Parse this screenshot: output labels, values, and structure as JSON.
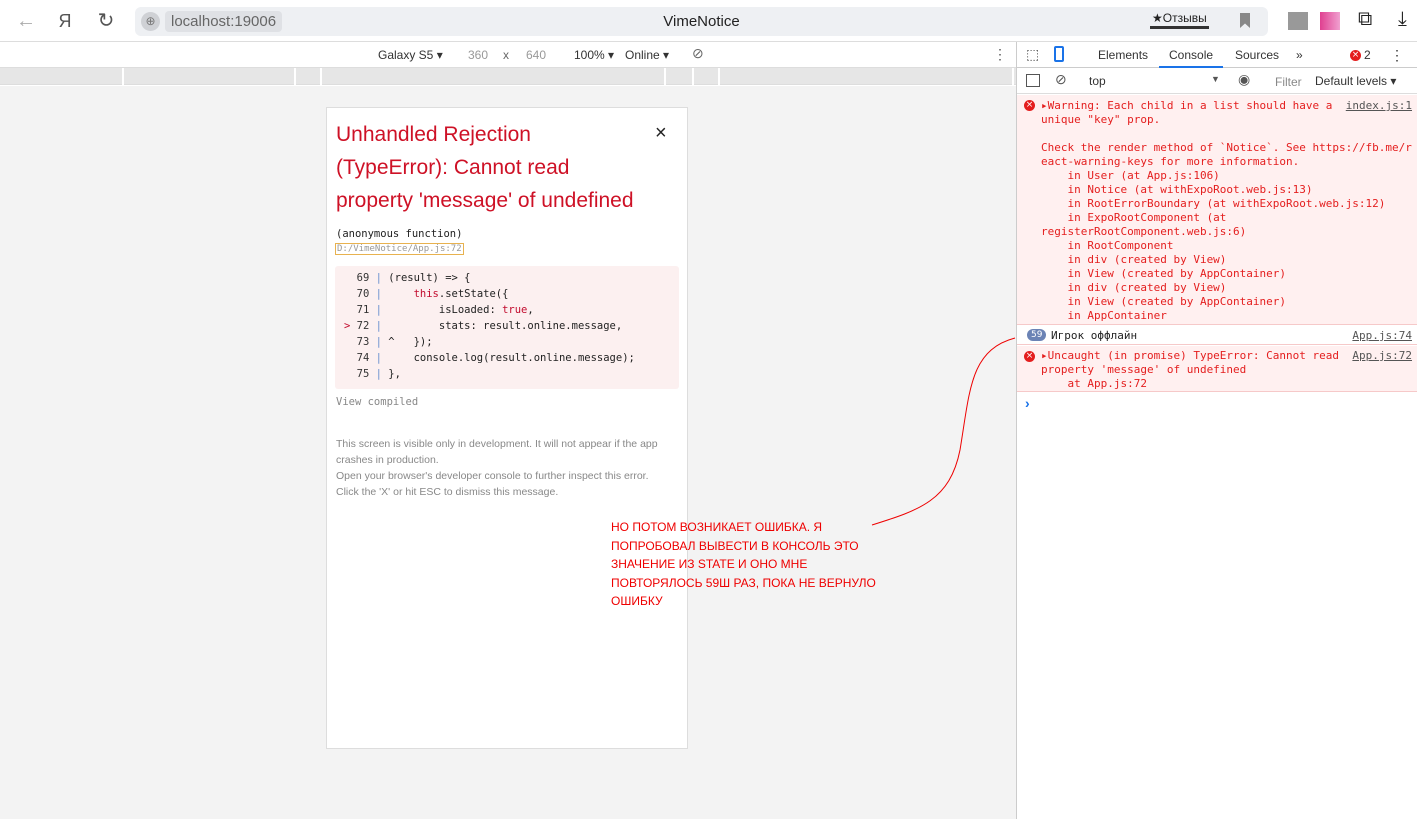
{
  "browser": {
    "url": "localhost:19006",
    "title": "VimeNotice",
    "reviews": "★Отзывы",
    "yandex": "Я"
  },
  "device_toolbar": {
    "device": "Galaxy S5 ▾",
    "width": "360",
    "x": "x",
    "height": "640",
    "zoom": "100% ▾",
    "network": "Online ▾"
  },
  "error_overlay": {
    "title": "Unhandled Rejection (TypeError): Cannot read property 'message' of undefined",
    "function": "(anonymous function)",
    "location": "D:/VimeNotice/App.js:72",
    "code_lines": [
      {
        "marker": " ",
        "num": "69",
        "pre": "(result) => {",
        "kw": "",
        "post": ""
      },
      {
        "marker": " ",
        "num": "70",
        "pre": "    ",
        "kw": "this",
        "post": ".setState({"
      },
      {
        "marker": " ",
        "num": "71",
        "pre": "        isLoaded: ",
        "kw": "true",
        "post": ","
      },
      {
        "marker": ">",
        "num": "72",
        "pre": "        stats: result.online.message,",
        "kw": "",
        "post": ""
      },
      {
        "marker": " ",
        "num": "73",
        "pre": "^   });",
        "kw": "",
        "post": ""
      },
      {
        "marker": " ",
        "num": "74",
        "pre": "    console.log(result.online.message);",
        "kw": "",
        "post": ""
      },
      {
        "marker": " ",
        "num": "75",
        "pre": "},",
        "kw": "",
        "post": ""
      }
    ],
    "view_compiled": "View compiled",
    "note": [
      "This screen is visible only in development. It will not appear if the app crashes in production.",
      "Open your browser's developer console to further inspect this error.",
      "Click the 'X' or hit ESC to dismiss this message."
    ],
    "close": "×"
  },
  "annotation": "НО ПОТОМ ВОЗНИКАЕТ ОШИБКА. Я ПОПРОБОВАЛ ВЫВЕСТИ В КОНСОЛЬ ЭТО ЗНАЧЕНИЕ ИЗ STATE И ОНО МНЕ ПОВТОРЯЛОСЬ 59Ш РАЗ, ПОКА НЕ ВЕРНУЛО ОШИБКУ",
  "devtools": {
    "tabs": [
      "Elements",
      "Console",
      "Sources",
      "»"
    ],
    "active_tab": "Console",
    "error_count": "2",
    "context": "top",
    "filter": "Filter",
    "levels": "Default levels ▾",
    "messages": [
      {
        "type": "error",
        "lines": [
          "▸Warning: Each child in a list should have a",
          "unique \"key\" prop.",
          "",
          "Check the render method of `Notice`. See https://fb.me/r",
          "eact-warning-keys for more information.",
          "    in User (at App.js:106)",
          "    in Notice (at withExpoRoot.web.js:13)",
          "    in RootErrorBoundary (at withExpoRoot.web.js:12)",
          "    in ExpoRootComponent (at",
          "registerRootComponent.web.js:6)",
          "    in RootComponent",
          "    in div (created by View)",
          "    in View (created by AppContainer)",
          "    in div (created by View)",
          "    in View (created by AppContainer)",
          "    in AppContainer"
        ],
        "source": "index.js:1"
      },
      {
        "type": "log",
        "count": "59",
        "text": "Игрок оффлайн",
        "source": "App.js:74"
      },
      {
        "type": "error",
        "lines": [
          "▸Uncaught (in promise) TypeError: Cannot read",
          "property 'message' of undefined",
          "    at App.js:72"
        ],
        "source": "App.js:72"
      }
    ],
    "prompt": "›"
  }
}
